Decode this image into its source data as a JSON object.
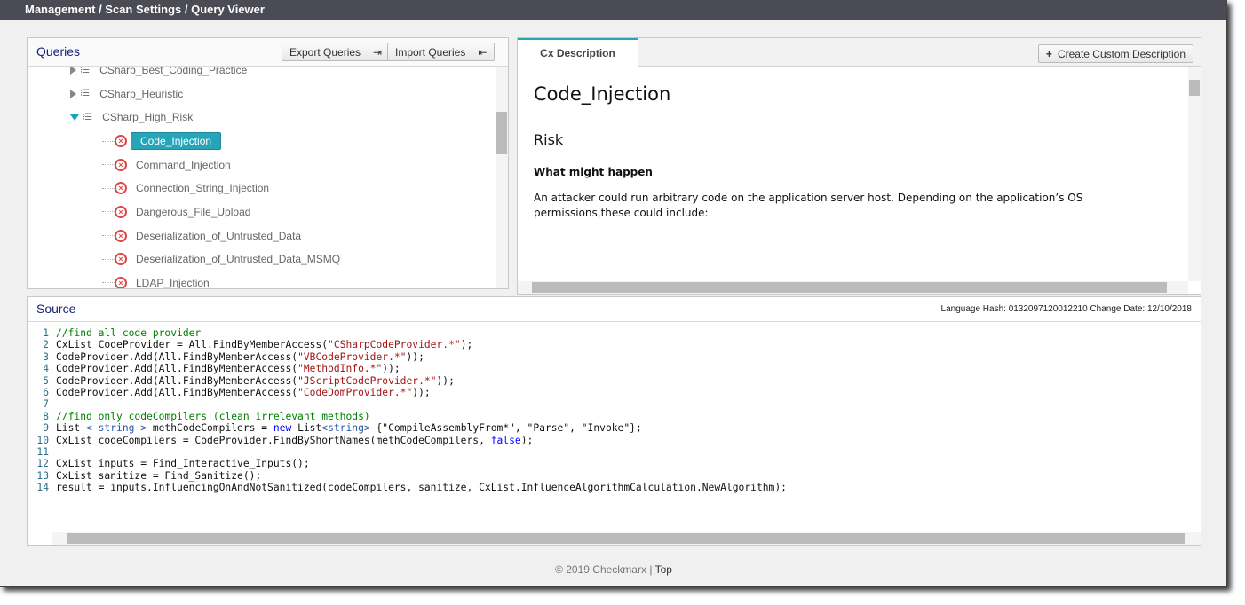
{
  "breadcrumb": "Management / Scan Settings / Query Viewer",
  "queries": {
    "title": "Queries",
    "export_label": "Export Queries",
    "import_label": "Import Queries",
    "groups": [
      {
        "label": "CSharp_Best_Coding_Practice",
        "expanded": false
      },
      {
        "label": "CSharp_Heuristic",
        "expanded": false
      },
      {
        "label": "CSharp_High_Risk",
        "expanded": true
      }
    ],
    "items": [
      "Code_Injection",
      "Command_Injection",
      "Connection_String_Injection",
      "Dangerous_File_Upload",
      "Deserialization_of_Untrusted_Data",
      "Deserialization_of_Untrusted_Data_MSMQ",
      "LDAP_Injection"
    ],
    "selected": "Code_Injection"
  },
  "description": {
    "tab": "Cx Description",
    "create_label": "Create Custom Description",
    "title": "Code_Injection",
    "risk": "Risk",
    "what_heading": "What might happen",
    "what_text": "An attacker could run arbitrary code on the application server host. Depending on the application’s OS permissions,these could include:"
  },
  "source": {
    "title": "Source",
    "meta": "Language Hash: 0132097120012210 Change Date: 12/10/2018",
    "lines": [
      [
        [
          "comment",
          "//find all code provider"
        ]
      ],
      [
        [
          "plain",
          "CxList CodeProvider = All.FindByMemberAccess("
        ],
        [
          "string",
          "\"CSharpCodeProvider.*\""
        ],
        [
          "plain",
          ");"
        ]
      ],
      [
        [
          "plain",
          "CodeProvider.Add(All.FindByMemberAccess("
        ],
        [
          "string",
          "\"VBCodeProvider.*\""
        ],
        [
          "plain",
          "));"
        ]
      ],
      [
        [
          "plain",
          "CodeProvider.Add(All.FindByMemberAccess("
        ],
        [
          "string",
          "\"MethodInfo.*\""
        ],
        [
          "plain",
          "));"
        ]
      ],
      [
        [
          "plain",
          "CodeProvider.Add(All.FindByMemberAccess("
        ],
        [
          "string",
          "\"JScriptCodeProvider.*\""
        ],
        [
          "plain",
          "));"
        ]
      ],
      [
        [
          "plain",
          "CodeProvider.Add(All.FindByMemberAccess("
        ],
        [
          "string",
          "\"CodeDomProvider.*\""
        ],
        [
          "plain",
          "));"
        ]
      ],
      [],
      [
        [
          "comment",
          "//find only codeCompilers (clean irrelevant methods)"
        ]
      ],
      [
        [
          "plain",
          "List "
        ],
        [
          "type",
          "< string >"
        ],
        [
          "plain",
          " methCodeCompilers = "
        ],
        [
          "kw",
          "new"
        ],
        [
          "plain",
          " List"
        ],
        [
          "type",
          "<string>"
        ],
        [
          "plain",
          " {\"CompileAssemblyFrom*\", \"Parse\", \"Invoke\"};"
        ]
      ],
      [
        [
          "plain",
          "CxList codeCompilers = CodeProvider.FindByShortNames(methCodeCompilers, "
        ],
        [
          "kw",
          "false"
        ],
        [
          "plain",
          ");"
        ]
      ],
      [],
      [
        [
          "plain",
          "CxList inputs = Find_Interactive_Inputs();"
        ]
      ],
      [
        [
          "plain",
          "CxList sanitize = Find_Sanitize();"
        ]
      ],
      [
        [
          "plain",
          "result = inputs.InfluencingOnAndNotSanitized(codeCompilers, sanitize, CxList.InfluenceAlgorithmCalculation.NewAlgorithm);"
        ]
      ]
    ]
  },
  "footer": {
    "copyright": "© 2019 Checkmarx",
    "separator": "|",
    "top_link": "Top"
  }
}
